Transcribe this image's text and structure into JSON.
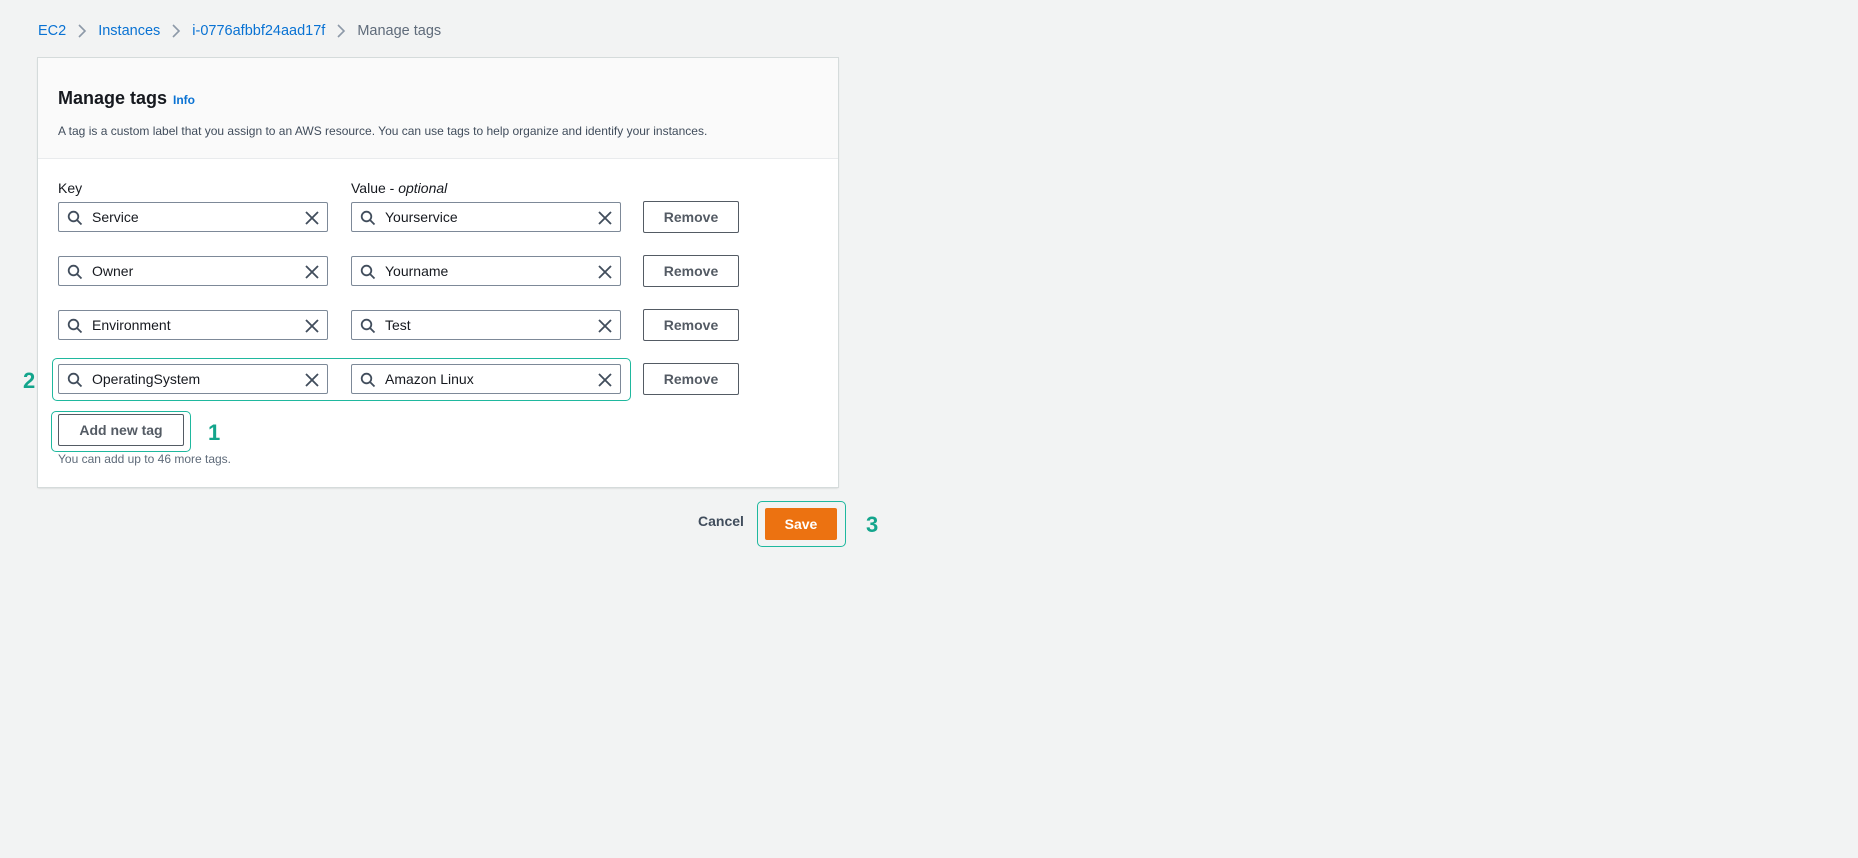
{
  "breadcrumb": {
    "items": [
      "EC2",
      "Instances",
      "i-0776afbbf24aad17f",
      "Manage tags"
    ]
  },
  "panel": {
    "title": "Manage tags",
    "info": "Info",
    "description": "A tag is a custom label that you assign to an AWS resource. You can use tags to help organize and identify your instances."
  },
  "columns": {
    "key_label": "Key",
    "value_label": "Value - ",
    "value_optional": "optional"
  },
  "tags": [
    {
      "key": "Service",
      "value": "Yourservice",
      "remove_label": "Remove"
    },
    {
      "key": "Owner",
      "value": "Yourname",
      "remove_label": "Remove"
    },
    {
      "key": "Environment",
      "value": "Test",
      "remove_label": "Remove"
    },
    {
      "key": "OperatingSystem",
      "value": "Amazon Linux",
      "remove_label": "Remove"
    }
  ],
  "add_tag": {
    "label": "Add new tag",
    "hint": "You can add up to 46 more tags."
  },
  "footer": {
    "cancel_label": "Cancel",
    "save_label": "Save"
  },
  "annotations": {
    "add_tag_number": "1",
    "tag_row_number": "2",
    "save_number": "3",
    "highlight_color": "#1fb89e"
  },
  "colors": {
    "link": "#0972d3",
    "primary_button": "#ec7211",
    "page_background": "#f2f3f3"
  },
  "icons": {
    "breadcrumb_separator": "chevron-right-icon",
    "field_leading": "search-icon",
    "field_trailing": "close-icon"
  }
}
